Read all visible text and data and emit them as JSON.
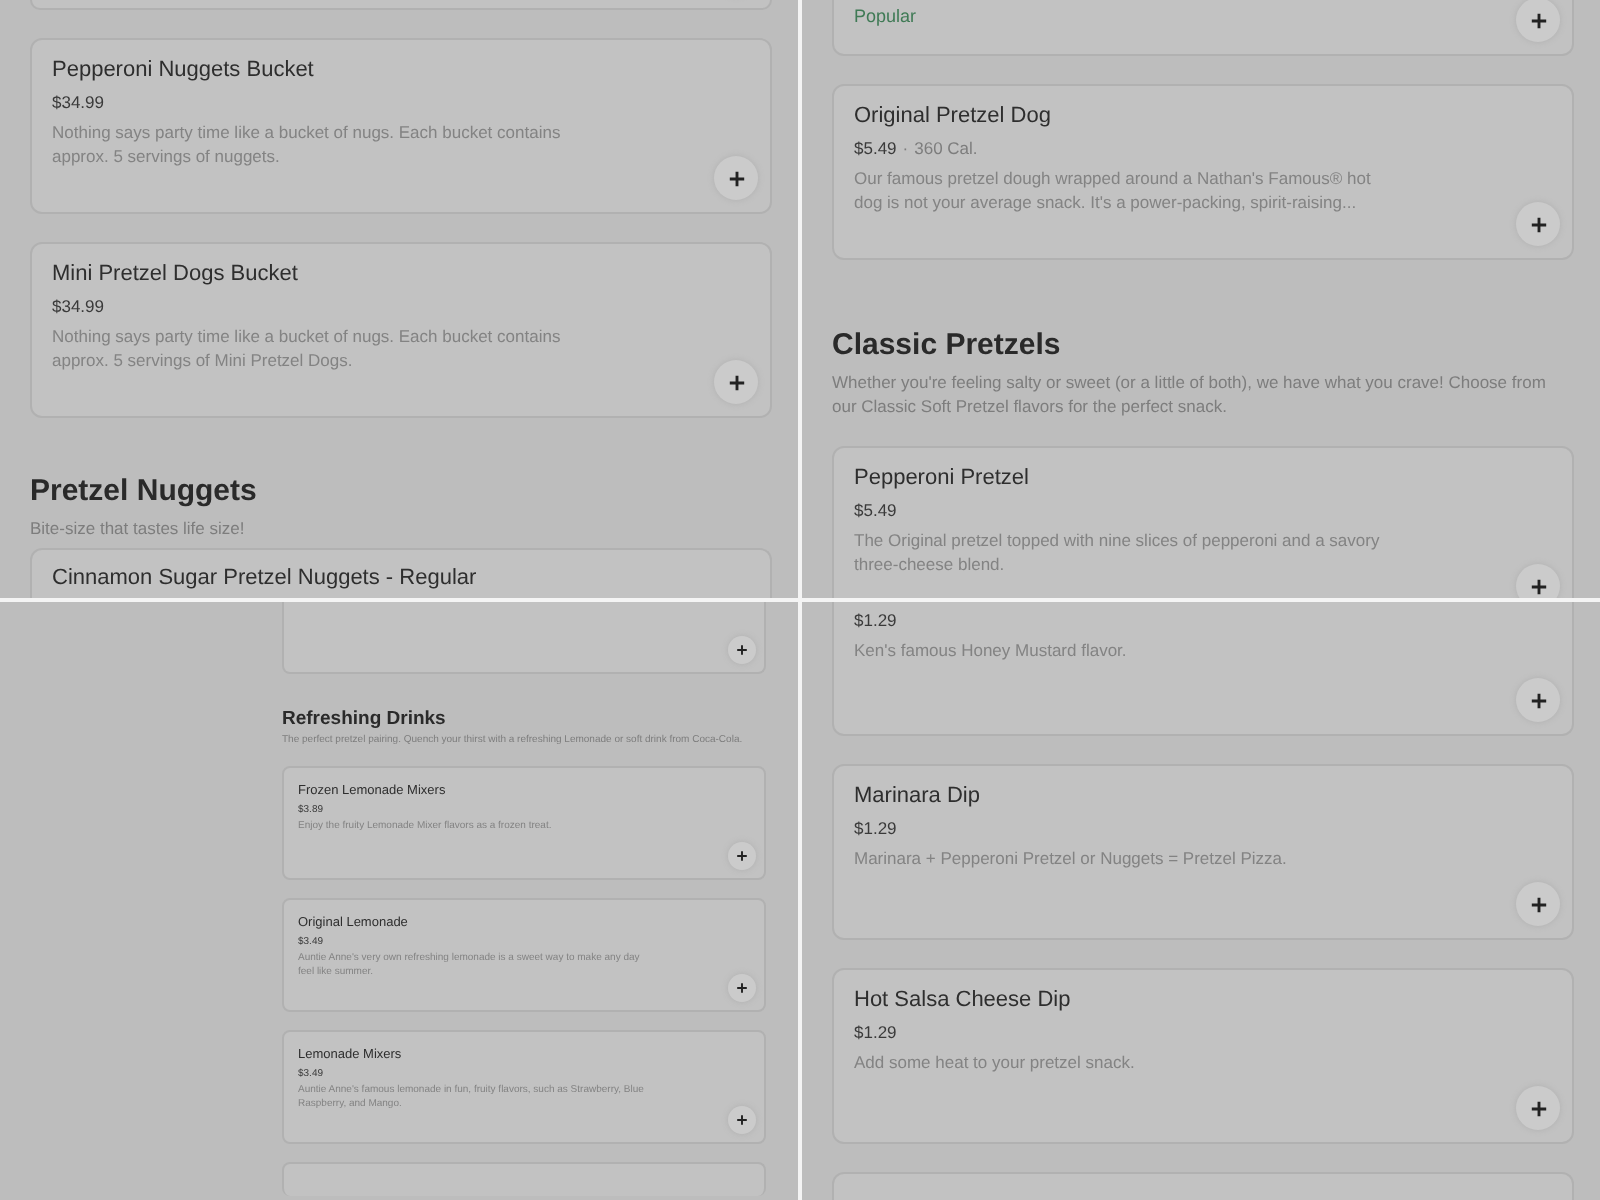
{
  "panels": [
    {
      "kind": "regular",
      "blocks": [
        {
          "kind": "card-tail"
        },
        {
          "kind": "card",
          "name": "Pepperoni Nuggets Bucket",
          "price": "$34.99",
          "description": "Nothing says party time like a bucket of nugs. Each bucket contains approx. 5 servings of nuggets."
        },
        {
          "kind": "card",
          "name": "Mini Pretzel Dogs Bucket",
          "price": "$34.99",
          "description": "Nothing says party time like a bucket of nugs. Each bucket contains approx. 5 servings of Mini Pretzel Dogs."
        },
        {
          "kind": "heading",
          "title": "Pretzel Nuggets",
          "subtitle": "Bite-size that tastes life size!"
        },
        {
          "kind": "card-head",
          "name": "Cinnamon Sugar Pretzel Nuggets - Regular"
        }
      ]
    },
    {
      "kind": "regular",
      "blocks": [
        {
          "kind": "card-tail",
          "tag": "Popular"
        },
        {
          "kind": "card",
          "name": "Original Pretzel Dog",
          "price": "$5.49",
          "separator": "·",
          "calories": "360 Cal.",
          "description": "Our famous pretzel dough wrapped around a Nathan's Famous® hot dog is not your average snack. It's a power-packing, spirit-raising..."
        },
        {
          "kind": "heading",
          "title": "Classic Pretzels",
          "subtitle": "Whether you're feeling salty or sweet (or a little of both), we have what you crave! Choose from our Classic Soft Pretzel flavors for the perfect snack."
        },
        {
          "kind": "card",
          "name": "Pepperoni Pretzel",
          "price": "$5.49",
          "description": "The Original pretzel topped with nine slices of pepperoni and a savory three-cheese blend."
        }
      ]
    },
    {
      "kind": "compact",
      "blocks": [
        {
          "kind": "card-tail"
        },
        {
          "kind": "heading",
          "title": "Refreshing Drinks",
          "subtitle": "The perfect pretzel pairing. Quench your thirst with a refreshing Lemonade or soft drink from Coca-Cola."
        },
        {
          "kind": "card",
          "name": "Frozen Lemonade Mixers",
          "price": "$3.89",
          "description": "Enjoy the fruity Lemonade Mixer flavors as a frozen treat."
        },
        {
          "kind": "card",
          "name": "Original Lemonade",
          "price": "$3.49",
          "description": "Auntie Anne's very own refreshing lemonade is a sweet way to make any day feel like summer."
        },
        {
          "kind": "card",
          "name": "Lemonade Mixers",
          "price": "$3.49",
          "description": "Auntie Anne's famous lemonade in fun, fruity flavors, such as Strawberry, Blue Raspberry, and Mango."
        },
        {
          "kind": "card-head"
        }
      ]
    },
    {
      "kind": "regular",
      "blocks": [
        {
          "kind": "card-tail",
          "price": "$1.29",
          "description": "Ken's famous Honey Mustard flavor."
        },
        {
          "kind": "card",
          "name": "Marinara Dip",
          "price": "$1.29",
          "description": "Marinara + Pepperoni Pretzel or Nuggets = Pretzel Pizza."
        },
        {
          "kind": "card",
          "name": "Hot Salsa Cheese Dip",
          "price": "$1.29",
          "description": "Add some heat to your pretzel snack."
        },
        {
          "kind": "card-head"
        }
      ]
    }
  ]
}
